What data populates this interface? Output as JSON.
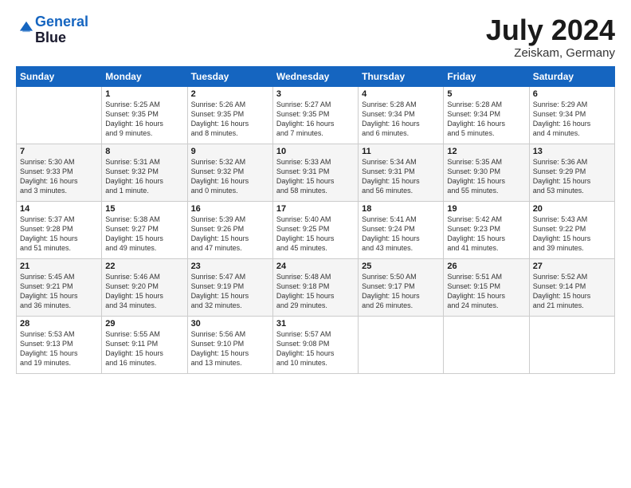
{
  "header": {
    "logo_line1": "General",
    "logo_line2": "Blue",
    "month": "July 2024",
    "location": "Zeiskam, Germany"
  },
  "columns": [
    "Sunday",
    "Monday",
    "Tuesday",
    "Wednesday",
    "Thursday",
    "Friday",
    "Saturday"
  ],
  "weeks": [
    [
      {
        "day": "",
        "info": ""
      },
      {
        "day": "1",
        "info": "Sunrise: 5:25 AM\nSunset: 9:35 PM\nDaylight: 16 hours\nand 9 minutes."
      },
      {
        "day": "2",
        "info": "Sunrise: 5:26 AM\nSunset: 9:35 PM\nDaylight: 16 hours\nand 8 minutes."
      },
      {
        "day": "3",
        "info": "Sunrise: 5:27 AM\nSunset: 9:35 PM\nDaylight: 16 hours\nand 7 minutes."
      },
      {
        "day": "4",
        "info": "Sunrise: 5:28 AM\nSunset: 9:34 PM\nDaylight: 16 hours\nand 6 minutes."
      },
      {
        "day": "5",
        "info": "Sunrise: 5:28 AM\nSunset: 9:34 PM\nDaylight: 16 hours\nand 5 minutes."
      },
      {
        "day": "6",
        "info": "Sunrise: 5:29 AM\nSunset: 9:34 PM\nDaylight: 16 hours\nand 4 minutes."
      }
    ],
    [
      {
        "day": "7",
        "info": "Sunrise: 5:30 AM\nSunset: 9:33 PM\nDaylight: 16 hours\nand 3 minutes."
      },
      {
        "day": "8",
        "info": "Sunrise: 5:31 AM\nSunset: 9:32 PM\nDaylight: 16 hours\nand 1 minute."
      },
      {
        "day": "9",
        "info": "Sunrise: 5:32 AM\nSunset: 9:32 PM\nDaylight: 16 hours\nand 0 minutes."
      },
      {
        "day": "10",
        "info": "Sunrise: 5:33 AM\nSunset: 9:31 PM\nDaylight: 15 hours\nand 58 minutes."
      },
      {
        "day": "11",
        "info": "Sunrise: 5:34 AM\nSunset: 9:31 PM\nDaylight: 15 hours\nand 56 minutes."
      },
      {
        "day": "12",
        "info": "Sunrise: 5:35 AM\nSunset: 9:30 PM\nDaylight: 15 hours\nand 55 minutes."
      },
      {
        "day": "13",
        "info": "Sunrise: 5:36 AM\nSunset: 9:29 PM\nDaylight: 15 hours\nand 53 minutes."
      }
    ],
    [
      {
        "day": "14",
        "info": "Sunrise: 5:37 AM\nSunset: 9:28 PM\nDaylight: 15 hours\nand 51 minutes."
      },
      {
        "day": "15",
        "info": "Sunrise: 5:38 AM\nSunset: 9:27 PM\nDaylight: 15 hours\nand 49 minutes."
      },
      {
        "day": "16",
        "info": "Sunrise: 5:39 AM\nSunset: 9:26 PM\nDaylight: 15 hours\nand 47 minutes."
      },
      {
        "day": "17",
        "info": "Sunrise: 5:40 AM\nSunset: 9:25 PM\nDaylight: 15 hours\nand 45 minutes."
      },
      {
        "day": "18",
        "info": "Sunrise: 5:41 AM\nSunset: 9:24 PM\nDaylight: 15 hours\nand 43 minutes."
      },
      {
        "day": "19",
        "info": "Sunrise: 5:42 AM\nSunset: 9:23 PM\nDaylight: 15 hours\nand 41 minutes."
      },
      {
        "day": "20",
        "info": "Sunrise: 5:43 AM\nSunset: 9:22 PM\nDaylight: 15 hours\nand 39 minutes."
      }
    ],
    [
      {
        "day": "21",
        "info": "Sunrise: 5:45 AM\nSunset: 9:21 PM\nDaylight: 15 hours\nand 36 minutes."
      },
      {
        "day": "22",
        "info": "Sunrise: 5:46 AM\nSunset: 9:20 PM\nDaylight: 15 hours\nand 34 minutes."
      },
      {
        "day": "23",
        "info": "Sunrise: 5:47 AM\nSunset: 9:19 PM\nDaylight: 15 hours\nand 32 minutes."
      },
      {
        "day": "24",
        "info": "Sunrise: 5:48 AM\nSunset: 9:18 PM\nDaylight: 15 hours\nand 29 minutes."
      },
      {
        "day": "25",
        "info": "Sunrise: 5:50 AM\nSunset: 9:17 PM\nDaylight: 15 hours\nand 26 minutes."
      },
      {
        "day": "26",
        "info": "Sunrise: 5:51 AM\nSunset: 9:15 PM\nDaylight: 15 hours\nand 24 minutes."
      },
      {
        "day": "27",
        "info": "Sunrise: 5:52 AM\nSunset: 9:14 PM\nDaylight: 15 hours\nand 21 minutes."
      }
    ],
    [
      {
        "day": "28",
        "info": "Sunrise: 5:53 AM\nSunset: 9:13 PM\nDaylight: 15 hours\nand 19 minutes."
      },
      {
        "day": "29",
        "info": "Sunrise: 5:55 AM\nSunset: 9:11 PM\nDaylight: 15 hours\nand 16 minutes."
      },
      {
        "day": "30",
        "info": "Sunrise: 5:56 AM\nSunset: 9:10 PM\nDaylight: 15 hours\nand 13 minutes."
      },
      {
        "day": "31",
        "info": "Sunrise: 5:57 AM\nSunset: 9:08 PM\nDaylight: 15 hours\nand 10 minutes."
      },
      {
        "day": "",
        "info": ""
      },
      {
        "day": "",
        "info": ""
      },
      {
        "day": "",
        "info": ""
      }
    ]
  ]
}
